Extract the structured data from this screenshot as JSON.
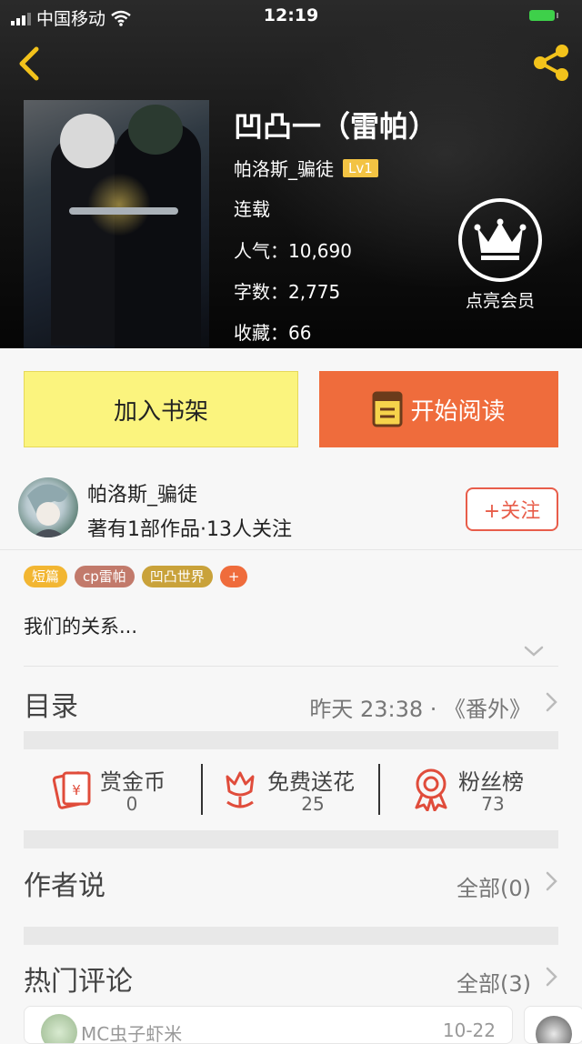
{
  "status_bar": {
    "carrier": "中国移动",
    "time": "12:19"
  },
  "book": {
    "title": "凹凸一（雷帕）",
    "author": "帕洛斯_骗徒",
    "level": "Lv1",
    "state": "连载",
    "popularity_label": "人气：",
    "popularity": "10,690",
    "words_label": "字数：",
    "words": "2,775",
    "favorites_label": "收藏：",
    "favorites": "66"
  },
  "vip": {
    "label": "点亮会员"
  },
  "actions": {
    "add_shelf": "加入书架",
    "start_reading": "开始阅读"
  },
  "author_card": {
    "name": "帕洛斯_骗徒",
    "stats": "著有1部作品·13人关注",
    "follow": "+关注"
  },
  "tags": [
    {
      "label": "短篇",
      "color": "#f2b632"
    },
    {
      "label": "cp雷帕",
      "color": "#c27a6b"
    },
    {
      "label": "凹凸世界",
      "color": "#c9a23a"
    },
    {
      "label": "+",
      "color": "#ef6c3c"
    }
  ],
  "description": "我们的关系...",
  "toc": {
    "label": "目录",
    "latest": "昨天 23:38 · 《番外》"
  },
  "stats": {
    "reward": {
      "label": "赏金币",
      "value": "0"
    },
    "flowers": {
      "label": "免费送花",
      "value": "25"
    },
    "fans": {
      "label": "粉丝榜",
      "value": "73"
    }
  },
  "author_says": {
    "label": "作者说",
    "right": "全部(0)"
  },
  "hot_comments": {
    "label": "热门评论",
    "right": "全部(3)"
  },
  "comment_preview": {
    "user": "MC虫子虾米",
    "date": "10-22"
  },
  "colors": {
    "accent": "#ef6c3c",
    "shelf": "#fbf47e",
    "tag_level": "#f3c343",
    "icon_red": "#e04c3b"
  }
}
